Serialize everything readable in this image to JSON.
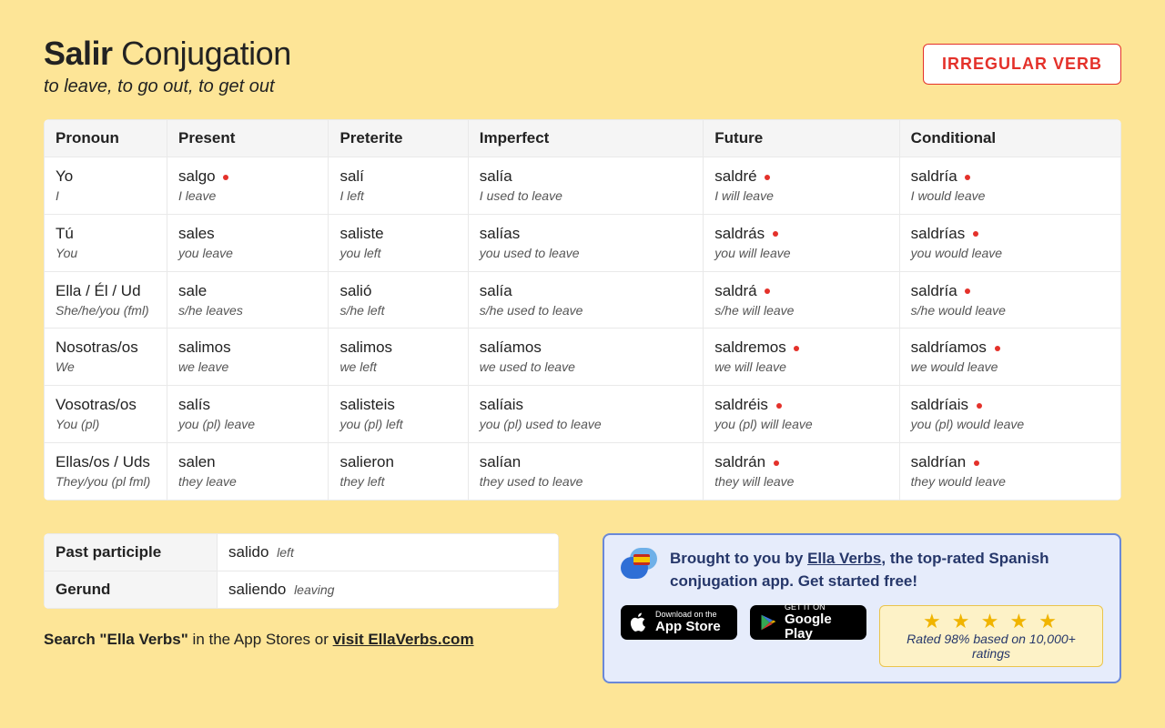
{
  "header": {
    "verb": "Salir",
    "label": "Conjugation",
    "subtitle": "to leave, to go out, to get out",
    "badge": "IRREGULAR VERB"
  },
  "columns": [
    "Pronoun",
    "Present",
    "Preterite",
    "Imperfect",
    "Future",
    "Conditional"
  ],
  "pronouns": [
    {
      "sp": "Yo",
      "en": "I"
    },
    {
      "sp": "Tú",
      "en": "You"
    },
    {
      "sp": "Ella / Él / Ud",
      "en": "She/he/you (fml)"
    },
    {
      "sp": "Nosotras/os",
      "en": "We"
    },
    {
      "sp": "Vosotras/os",
      "en": "You (pl)"
    },
    {
      "sp": "Ellas/os / Uds",
      "en": "They/you (pl fml)"
    }
  ],
  "cells": [
    [
      {
        "sp": "salgo",
        "en": "I leave",
        "irr": true
      },
      {
        "sp": "salí",
        "en": "I left",
        "irr": false
      },
      {
        "sp": "salía",
        "en": "I used to leave",
        "irr": false
      },
      {
        "sp": "saldré",
        "en": "I will leave",
        "irr": true
      },
      {
        "sp": "saldría",
        "en": "I would leave",
        "irr": true
      }
    ],
    [
      {
        "sp": "sales",
        "en": "you leave",
        "irr": false
      },
      {
        "sp": "saliste",
        "en": "you left",
        "irr": false
      },
      {
        "sp": "salías",
        "en": "you used to leave",
        "irr": false
      },
      {
        "sp": "saldrás",
        "en": "you will leave",
        "irr": true
      },
      {
        "sp": "saldrías",
        "en": "you would leave",
        "irr": true
      }
    ],
    [
      {
        "sp": "sale",
        "en": "s/he leaves",
        "irr": false
      },
      {
        "sp": "salió",
        "en": "s/he left",
        "irr": false
      },
      {
        "sp": "salía",
        "en": "s/he used to leave",
        "irr": false
      },
      {
        "sp": "saldrá",
        "en": "s/he will leave",
        "irr": true
      },
      {
        "sp": "saldría",
        "en": "s/he would leave",
        "irr": true
      }
    ],
    [
      {
        "sp": "salimos",
        "en": "we leave",
        "irr": false
      },
      {
        "sp": "salimos",
        "en": "we left",
        "irr": false
      },
      {
        "sp": "salíamos",
        "en": "we used to leave",
        "irr": false
      },
      {
        "sp": "saldremos",
        "en": "we will leave",
        "irr": true
      },
      {
        "sp": "saldríamos",
        "en": "we would leave",
        "irr": true
      }
    ],
    [
      {
        "sp": "salís",
        "en": "you (pl) leave",
        "irr": false
      },
      {
        "sp": "salisteis",
        "en": "you (pl) left",
        "irr": false
      },
      {
        "sp": "salíais",
        "en": "you (pl) used to leave",
        "irr": false
      },
      {
        "sp": "saldréis",
        "en": "you (pl) will leave",
        "irr": true
      },
      {
        "sp": "saldríais",
        "en": "you (pl) would leave",
        "irr": true
      }
    ],
    [
      {
        "sp": "salen",
        "en": "they leave",
        "irr": false
      },
      {
        "sp": "salieron",
        "en": "they left",
        "irr": false
      },
      {
        "sp": "salían",
        "en": "they used to leave",
        "irr": false
      },
      {
        "sp": "saldrán",
        "en": "they will leave",
        "irr": true
      },
      {
        "sp": "saldrían",
        "en": "they would leave",
        "irr": true
      }
    ]
  ],
  "participles": {
    "pp_label": "Past participle",
    "pp_sp": "salido",
    "pp_en": "left",
    "ger_label": "Gerund",
    "ger_sp": "saliendo",
    "ger_en": "leaving"
  },
  "search_line": {
    "lead": "Search \"Ella Verbs\"",
    "mid": " in the App Stores or ",
    "link": "visit EllaVerbs.com"
  },
  "promo": {
    "text1": "Brought to you by ",
    "link": "Ella Verbs",
    "text2": ", the top-rated Spanish conjugation app. Get started free!",
    "appstore_small": "Download on the",
    "appstore_big": "App Store",
    "gplay_small": "GET IT ON",
    "gplay_big": "Google Play",
    "rating_text": "Rated 98% based on 10,000+ ratings"
  }
}
